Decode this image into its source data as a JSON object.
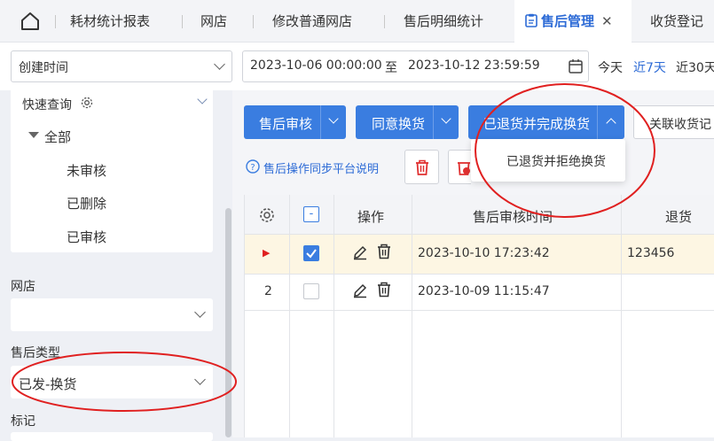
{
  "tabs": {
    "items": [
      "耗材统计报表",
      "网店",
      "修改普通网店",
      "售后明细统计",
      "售后管理",
      "收货登记"
    ],
    "close_glyph": "✕"
  },
  "filter": {
    "time_field": "创建时间",
    "start": "2023-10-06 00:00:00",
    "separator": "至",
    "end": "2023-10-12 23:59:59",
    "quick_ranges": [
      "今天",
      "近7天",
      "近30天"
    ]
  },
  "sidebar": {
    "quick_query": "快速查询",
    "tree_root": "全部",
    "tree_items": [
      "未审核",
      "已删除",
      "已审核"
    ],
    "shop_label": "网店",
    "shop_value": "",
    "type_label": "售后类型",
    "type_value": "已发-换货",
    "mark_label": "标记"
  },
  "toolbar": {
    "review": "售后审核",
    "exchange": "同意换货",
    "returned_complete": "已退货并完成换货",
    "link_receipt": "关联收货记",
    "sync_help": "售后操作同步平台说明"
  },
  "dropdown": {
    "item": "已退货并拒绝换货"
  },
  "table": {
    "headers": [
      "操作",
      "售后审核时间",
      "退货"
    ],
    "header_checkbox": "-",
    "rows": [
      {
        "index": "▶",
        "checked": true,
        "time": "2023-10-10 17:23:42",
        "return": "123456"
      },
      {
        "index": "2",
        "checked": false,
        "time": "2023-10-09 11:15:47",
        "return": ""
      }
    ]
  },
  "colors": {
    "accent": "#3a7de0",
    "annotation": "#e02020",
    "row_highlight": "#fdf6e3"
  }
}
